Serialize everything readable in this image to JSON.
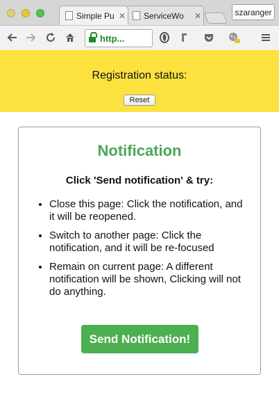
{
  "browser": {
    "tabs": [
      {
        "title": "Simple Pu",
        "close": "✕",
        "active": true
      },
      {
        "title": "ServiceWo",
        "close": "✕",
        "active": false
      }
    ],
    "profile_name": "szaranger",
    "url": "http...",
    "toolbar_icons": [
      "back-icon",
      "forward-icon",
      "reload-icon",
      "home-icon",
      "star-icon",
      "opera-icon",
      "extension-icon",
      "pocket-icon",
      "cookie-icon",
      "menu-icon"
    ]
  },
  "banner": {
    "status_label": "Registration status:",
    "reset_label": "Reset",
    "background": "#fde23f"
  },
  "card": {
    "title": "Notification",
    "subtitle": "Click 'Send notification' & try:",
    "items": [
      "Close this page: Click the notification, and it will be reopened.",
      "Switch to another page: Click the notification, and it will be re-focused",
      "Remain on current page: A different notification will be shown, Clicking will not do anything."
    ],
    "send_label": "Send Notification!",
    "title_color": "#4aa65a",
    "button_color": "#4caf50"
  }
}
